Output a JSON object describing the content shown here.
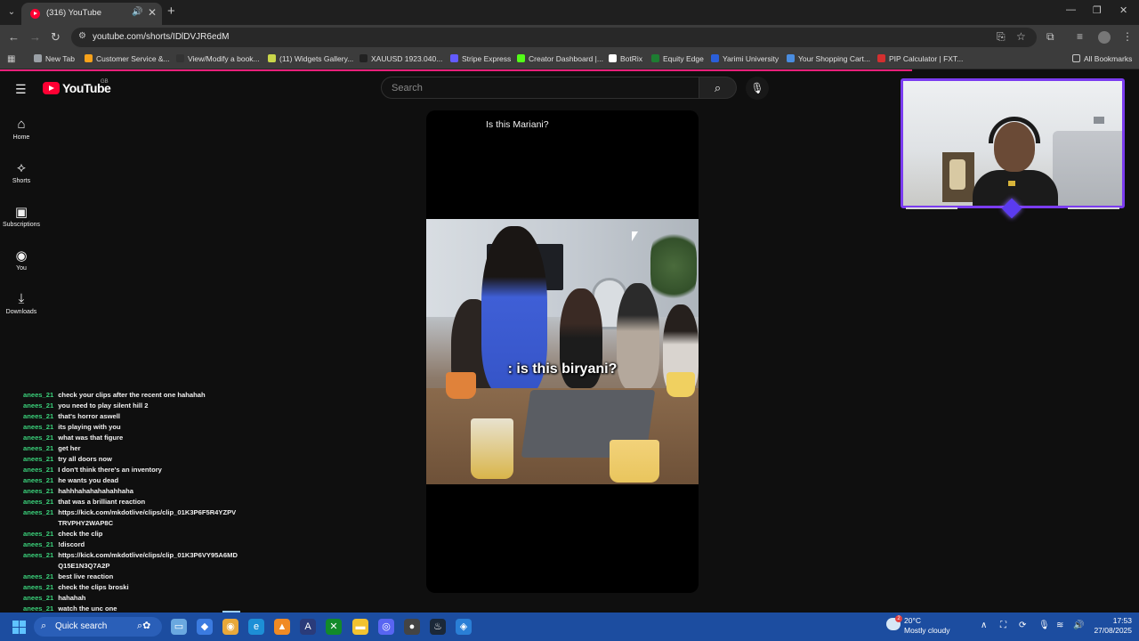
{
  "browser": {
    "tab_title": "(316) YouTube",
    "url": "youtube.com/shorts/IDlDVJR6edM",
    "bookmarks": [
      {
        "label": "New Tab",
        "color": "#9aa0a6"
      },
      {
        "label": "Customer Service &...",
        "color": "#f7a21b"
      },
      {
        "label": "View/Modify a book...",
        "color": "#333333"
      },
      {
        "label": "(11) Widgets Gallery...",
        "color": "#c9d64a"
      },
      {
        "label": "XAUUSD 1923.040...",
        "color": "#222222"
      },
      {
        "label": "Stripe Express",
        "color": "#635bff"
      },
      {
        "label": "Creator Dashboard |...",
        "color": "#53fc18"
      },
      {
        "label": "BotRix",
        "color": "#ffffff"
      },
      {
        "label": "Equity Edge",
        "color": "#1e7d32"
      },
      {
        "label": "Yarimi University",
        "color": "#2b5fd9"
      },
      {
        "label": "Your Shopping Cart...",
        "color": "#4a8de0"
      },
      {
        "label": "PIP Calculator | FXT...",
        "color": "#d32f2f"
      }
    ],
    "all_bookmarks": "All Bookmarks"
  },
  "youtube": {
    "wordmark": "YouTube",
    "country": "GB",
    "search_placeholder": "Search",
    "nav": [
      {
        "label": "Home",
        "icon": "home-icon"
      },
      {
        "label": "Shorts",
        "icon": "shorts-icon"
      },
      {
        "label": "Subscriptions",
        "icon": "subscriptions-icon"
      },
      {
        "label": "You",
        "icon": "you-icon"
      },
      {
        "label": "Downloads",
        "icon": "downloads-icon"
      }
    ],
    "short_title": "Is this Mariani?",
    "caption": ": is this biryani?"
  },
  "chat": [
    {
      "user": "anees_21",
      "msg": "check your clips after the recent one hahahah"
    },
    {
      "user": "anees_21",
      "msg": "you need to play silent hill 2"
    },
    {
      "user": "anees_21",
      "msg": "that's horror aswell"
    },
    {
      "user": "anees_21",
      "msg": "its playing with you"
    },
    {
      "user": "anees_21",
      "msg": "what was that figure"
    },
    {
      "user": "anees_21",
      "msg": "get her"
    },
    {
      "user": "anees_21",
      "msg": "try all doors now"
    },
    {
      "user": "anees_21",
      "msg": "I don't think there's an inventory"
    },
    {
      "user": "anees_21",
      "msg": "he wants you dead"
    },
    {
      "user": "anees_21",
      "msg": "hahhhahahahahahhaha"
    },
    {
      "user": "anees_21",
      "msg": "that was a brilliant reaction"
    },
    {
      "user": "anees_21",
      "msg": "https://kick.com/mkdotlive/clips/clip_01K3P6F5R4YZPV TRVPHY2WAP8C"
    },
    {
      "user": "anees_21",
      "msg": "check the clip"
    },
    {
      "user": "anees_21",
      "msg": "!discord"
    },
    {
      "user": "anees_21",
      "msg": "https://kick.com/mkdotlive/clips/clip_01K3P6VY95A6MD Q15E1N3Q7A2P"
    },
    {
      "user": "anees_21",
      "msg": "best live reaction"
    },
    {
      "user": "anees_21",
      "msg": "check the clips broski"
    },
    {
      "user": "anees_21",
      "msg": "hahahah"
    },
    {
      "user": "anees_21",
      "msg": "watch the unc one"
    }
  ],
  "taskbar": {
    "search_label": "Quick search",
    "weather_badge": "2",
    "temperature": "20°C",
    "weather": "Mostly cloudy",
    "time": "17:53",
    "date": "27/08/2025"
  },
  "colors": {
    "youtube_red": "#ff0033",
    "chat_username": "#3ad07a",
    "webcam_border": "#7b3cf0",
    "taskbar": "#1c4da0"
  }
}
